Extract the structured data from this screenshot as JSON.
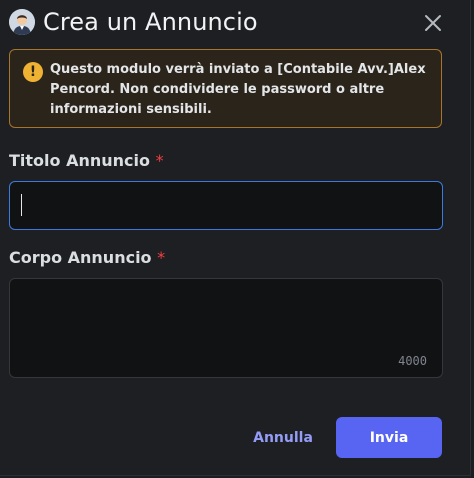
{
  "modal": {
    "title": "Crea un Annuncio",
    "avatar_icon": "user-avatar-icon",
    "close_icon": "close-icon"
  },
  "warning": {
    "icon": "exclamation-icon",
    "text": "Questo modulo verrà inviato a [Contabile Avv.]Alex Pencord. Non condividere le password o altre informazioni sensibili.",
    "border_color": "#a9742b",
    "icon_color": "#f0b232"
  },
  "fields": {
    "title_label": "Titolo Annuncio",
    "body_label": "Corpo Annuncio",
    "required_mark": "*",
    "title_value": "",
    "body_value": "",
    "body_counter": "4000"
  },
  "actions": {
    "cancel_label": "Annulla",
    "submit_label": "Invia",
    "accent_color": "#5865f2"
  }
}
